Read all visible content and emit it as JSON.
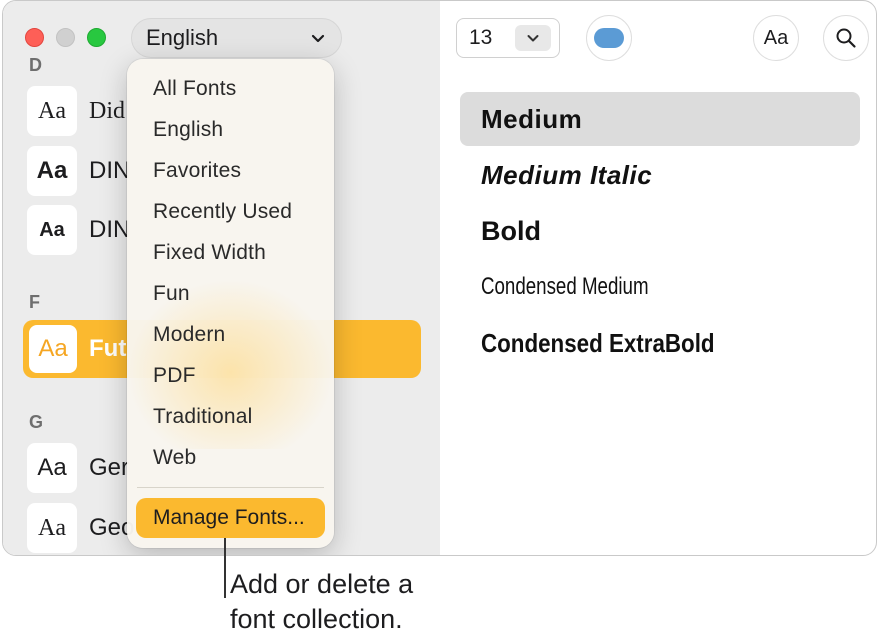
{
  "sidebar": {
    "sections": [
      {
        "letter": "D"
      },
      {
        "letter": "F"
      },
      {
        "letter": "G"
      }
    ],
    "families": [
      {
        "tile": "Aa",
        "name": "Did"
      },
      {
        "tile": "Aa",
        "name": "DIN"
      },
      {
        "tile": "Aa",
        "name": "DIN"
      },
      {
        "tile": "Aa",
        "name": "Fut"
      },
      {
        "tile": "Aa",
        "name": "Ger"
      },
      {
        "tile": "Aa",
        "name": "Geo"
      }
    ]
  },
  "collection_select": {
    "value": "English"
  },
  "menu": {
    "items": [
      "All Fonts",
      "English",
      "Favorites",
      "Recently Used",
      "Fixed Width",
      "Fun",
      "Modern",
      "PDF",
      "Traditional",
      "Web"
    ],
    "manage_label": "Manage Fonts..."
  },
  "toolbar": {
    "font_size": "13",
    "color_swatch": "#5b9bd5",
    "aa_label": "Aa"
  },
  "typefaces": [
    "Medium",
    "Medium Italic",
    "Bold",
    "Condensed Medium",
    "Condensed ExtraBold"
  ],
  "callout": {
    "line1": "Add or delete a",
    "line2": "font collection."
  },
  "colors": {
    "accent": "#fbb92f",
    "sidebar_bg": "#ececec",
    "selected_typeface_bg": "#dcdcdc"
  }
}
